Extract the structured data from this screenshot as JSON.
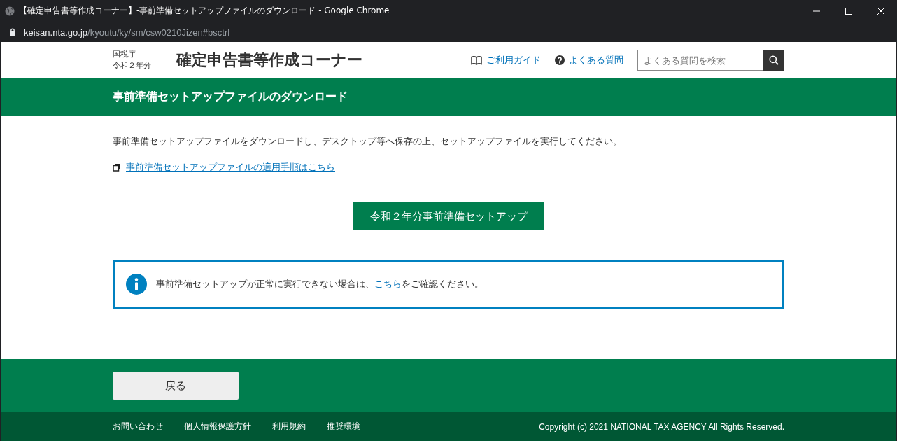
{
  "window": {
    "title": "【確定申告書等作成コーナー】-事前準備セットアップファイルのダウンロード - Google Chrome",
    "url_host": "keisan.nta.go.jp",
    "url_path": "/kyoutu/ky/sm/csw0210Jizen#bsctrl"
  },
  "header": {
    "agency": "国税庁",
    "year": "令和２年分",
    "site_title": "確定申告書等作成コーナー",
    "links": [
      {
        "kind": "guide",
        "label": "ご利用ガイド"
      },
      {
        "kind": "faq",
        "label": "よくある質問"
      }
    ],
    "search": {
      "placeholder": "よくある質問を検索"
    }
  },
  "page_title": "事前準備セットアップファイルのダウンロード",
  "intro": "事前準備セットアップファイルをダウンロードし、デスクトップ等へ保存の上、セットアップファイルを実行してください。",
  "procedure_link": "事前準備セットアップファイルの適用手順はこちら",
  "setup_button": "令和２年分事前準備セットアップ",
  "notice": {
    "before": "事前準備セットアップが正常に実行できない場合は、",
    "link": "こちら",
    "after": "をご確認ください。"
  },
  "back_button": "戻る",
  "footer": {
    "links": [
      "お問い合わせ",
      "個人情報保護方針",
      "利用規約",
      "推奨環境"
    ],
    "copyright": "Copyright (c) 2021 NATIONAL TAX AGENCY All Rights Reserved."
  }
}
